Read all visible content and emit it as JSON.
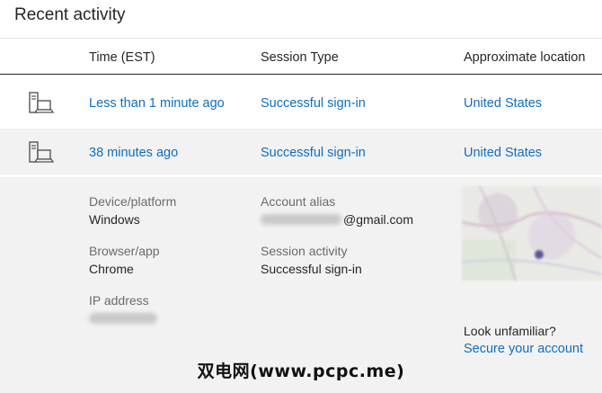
{
  "page": {
    "title": "Recent activity"
  },
  "table": {
    "headers": [
      "Time (EST)",
      "Session Type",
      "Approximate location"
    ],
    "rows": [
      {
        "icon": "computer-icon",
        "time": "Less than 1 minute ago",
        "session": "Successful sign-in",
        "location": "United States"
      },
      {
        "icon": "computer-icon",
        "time": "38 minutes ago",
        "session": "Successful sign-in",
        "location": "United States"
      }
    ]
  },
  "details": {
    "device_label": "Device/platform",
    "device_value": "Windows",
    "browser_label": "Browser/app",
    "browser_value": "Chrome",
    "ip_label": "IP address",
    "alias_label": "Account alias",
    "alias_suffix": "@gmail.com",
    "session_label": "Session activity",
    "session_value": "Successful sign-in",
    "unfamiliar_text": "Look unfamiliar?",
    "secure_link": "Secure your account"
  },
  "watermark": "双电网(www.pcpc.me)",
  "colors": {
    "link": "#106ebe",
    "text": "#262626",
    "label": "#6b6b6b",
    "expanded_bg": "#f2f2f2"
  }
}
